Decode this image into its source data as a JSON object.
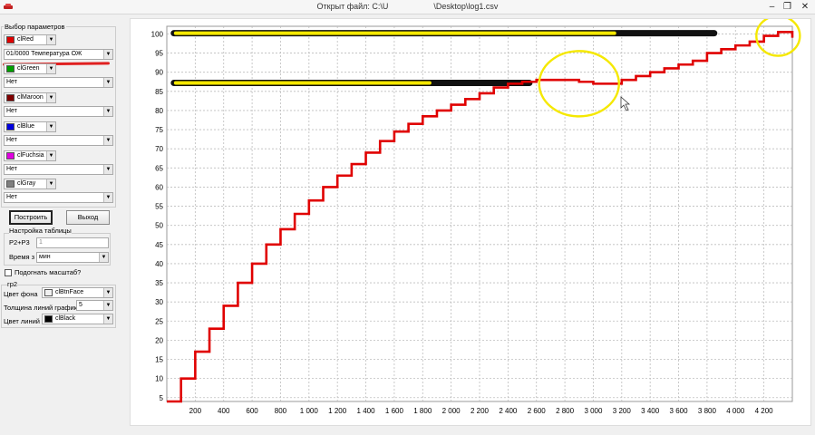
{
  "window": {
    "title": "Открыт файл: C:\\U                    \\Desktop\\log1.csv",
    "min_icon": "minimize-icon",
    "max_icon": "maximize-icon",
    "close_icon": "close-icon"
  },
  "panel": {
    "params_label": "Выбор параметров",
    "channels": [
      {
        "color_name": "clRed",
        "color": "#e00000",
        "param": "01/0000 Температура ОЖ"
      },
      {
        "color_name": "clGreen",
        "color": "#00a000",
        "param": "Нет"
      },
      {
        "color_name": "clMaroon",
        "color": "#800000",
        "param": "Нет"
      },
      {
        "color_name": "clBlue",
        "color": "#0000e0",
        "param": "Нет"
      },
      {
        "color_name": "clFuchsia",
        "color": "#e000e0",
        "param": "Нет"
      },
      {
        "color_name": "clGray",
        "color": "#808080",
        "param": "Нет"
      }
    ],
    "build_button": "Построить",
    "exit_button": "Выход",
    "table_settings_label": "Настройка таблицы",
    "p2p3_label": "P2+P3",
    "p2p3_value": "1",
    "time_label": "Время з",
    "time_unit": "мин",
    "scale_checkbox_label": "Подогнать масштаб?",
    "group2_label": "гр2",
    "bg_color_label": "Цвет фона",
    "bg_color_value": "clBtnFace",
    "line_width_label": "Толщина линий графика",
    "line_width_value": "5",
    "line_color_label": "Цвет линий",
    "line_color_value": "clBlack"
  },
  "chart_data": {
    "type": "line",
    "title": "",
    "xlabel": "",
    "ylabel": "",
    "xlim": [
      0,
      4400
    ],
    "ylim": [
      4,
      102
    ],
    "x_ticks": [
      200,
      400,
      600,
      800,
      1000,
      1200,
      1400,
      1600,
      1800,
      2000,
      2200,
      2400,
      2600,
      2800,
      3000,
      3200,
      3400,
      3600,
      3800,
      4000,
      4200
    ],
    "x_tick_labels": [
      "200",
      "400",
      "600",
      "800",
      "1 000",
      "1 200",
      "1 400",
      "1 600",
      "1 800",
      "2 000",
      "2 200",
      "2 400",
      "2 600",
      "2 800",
      "3 000",
      "3 200",
      "3 400",
      "3 600",
      "3 800",
      "4 000",
      "4 200"
    ],
    "y_ticks": [
      5,
      10,
      15,
      20,
      25,
      30,
      35,
      40,
      45,
      50,
      55,
      60,
      65,
      70,
      75,
      80,
      85,
      90,
      95,
      100
    ],
    "grid": true,
    "series": [
      {
        "color": "#e00000",
        "step": true,
        "x": [
          0,
          100,
          200,
          300,
          400,
          500,
          600,
          700,
          800,
          900,
          1000,
          1100,
          1200,
          1300,
          1400,
          1500,
          1600,
          1700,
          1800,
          1900,
          2000,
          2100,
          2200,
          2300,
          2400,
          2500,
          2600,
          2700,
          2800,
          2900,
          3000,
          3100,
          3200,
          3300,
          3400,
          3500,
          3600,
          3700,
          3800,
          3900,
          4000,
          4100,
          4200,
          4300,
          4400
        ],
        "y": [
          4,
          10,
          17,
          23,
          29,
          35,
          40,
          45,
          49,
          53,
          56.5,
          60,
          63,
          66,
          69,
          72,
          74.5,
          76.5,
          78.5,
          80,
          81.5,
          83,
          84.5,
          86,
          87,
          87.5,
          88,
          88,
          88,
          87.5,
          87,
          87,
          88,
          89,
          90,
          91,
          92,
          93,
          95,
          96,
          97,
          98,
          99.5,
          100.5,
          99
        ]
      }
    ],
    "annotations": [
      {
        "type": "highlighter-line",
        "x_start": 50,
        "x_end": 3850,
        "y": 100.2,
        "color": "#f5e800"
      },
      {
        "type": "highlighter-line",
        "x_start": 50,
        "x_end": 2550,
        "y": 87.2,
        "color": "#f5e800"
      },
      {
        "type": "circle",
        "x": 2900,
        "y": 87,
        "color": "#f5e800"
      },
      {
        "type": "circle",
        "x": 4300,
        "y": 99.5,
        "color": "#f5e800"
      }
    ]
  }
}
